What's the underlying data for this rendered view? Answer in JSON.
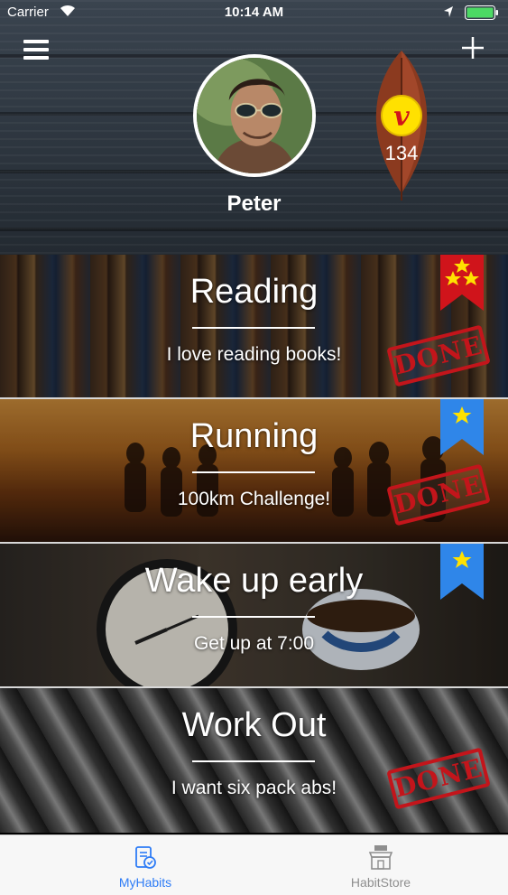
{
  "status_bar": {
    "carrier": "Carrier",
    "time": "10:14 AM"
  },
  "header": {
    "user_name": "Peter",
    "coin_symbol": "V",
    "coin_count": "134"
  },
  "habits": [
    {
      "title": "Reading",
      "subtitle": "I love reading books!",
      "ribbon": "red",
      "stars": 3,
      "done": true,
      "done_label": "DONE"
    },
    {
      "title": "Running",
      "subtitle": "100km Challenge!",
      "ribbon": "blue",
      "stars": 1,
      "done": true,
      "done_label": "DONE"
    },
    {
      "title": "Wake up early",
      "subtitle": "Get up at 7:00",
      "ribbon": "blue",
      "stars": 1,
      "done": false,
      "done_label": ""
    },
    {
      "title": "Work Out",
      "subtitle": "I want six pack abs!",
      "ribbon": "none",
      "stars": 0,
      "done": true,
      "done_label": "DONE"
    }
  ],
  "tab_bar": {
    "items": [
      {
        "label": "MyHabits",
        "icon": "my-habits-icon",
        "active": true
      },
      {
        "label": "HabitStore",
        "icon": "store-icon",
        "active": false
      }
    ]
  },
  "colors": {
    "accent": "#2e7cf6",
    "ribbon_red": "#d0141b",
    "ribbon_blue": "#2f86e9",
    "star": "#ffe100",
    "done_red": "#c3151b"
  }
}
